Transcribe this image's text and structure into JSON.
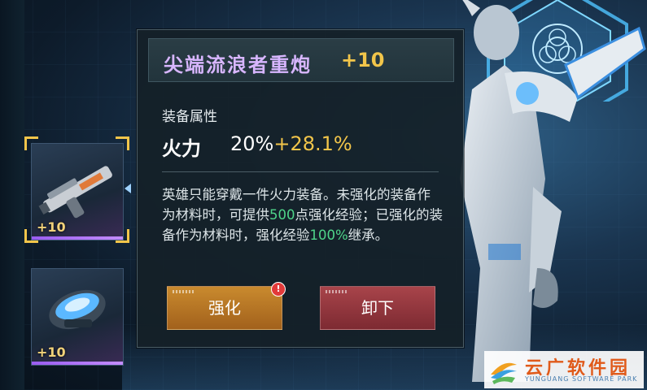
{
  "item": {
    "name": "尖端流浪者重炮",
    "level": "+10"
  },
  "attributes": {
    "title": "装备属性",
    "stat_name": "火力",
    "stat_base": "20%",
    "stat_bonus": "+28.1%"
  },
  "description": {
    "part1": "英雄只能穿戴一件火力装备。未强化的装备作为材料时，可提供",
    "value1": "500",
    "part2": "点强化经验；已强化的装备作为材料时，强化经验",
    "value2": "100%",
    "part3": "继承。"
  },
  "buttons": {
    "enhance": "强化",
    "unequip": "卸下",
    "enhance_alert": "!"
  },
  "slots": [
    {
      "icon": "heavy-cannon-icon",
      "level": "+10",
      "selected": true
    },
    {
      "icon": "armor-module-icon",
      "level": "+10",
      "selected": false
    }
  ],
  "watermark": {
    "name": "云广软件园",
    "name_en": "YUNGUANG SOFTWARE PARK"
  },
  "colors": {
    "item_name": "#d8b6ff",
    "level_gold": "#f2c54a",
    "highlight_green": "#4fd58a",
    "enhance_button": "#c98a2e",
    "unequip_button": "#a8444a"
  }
}
